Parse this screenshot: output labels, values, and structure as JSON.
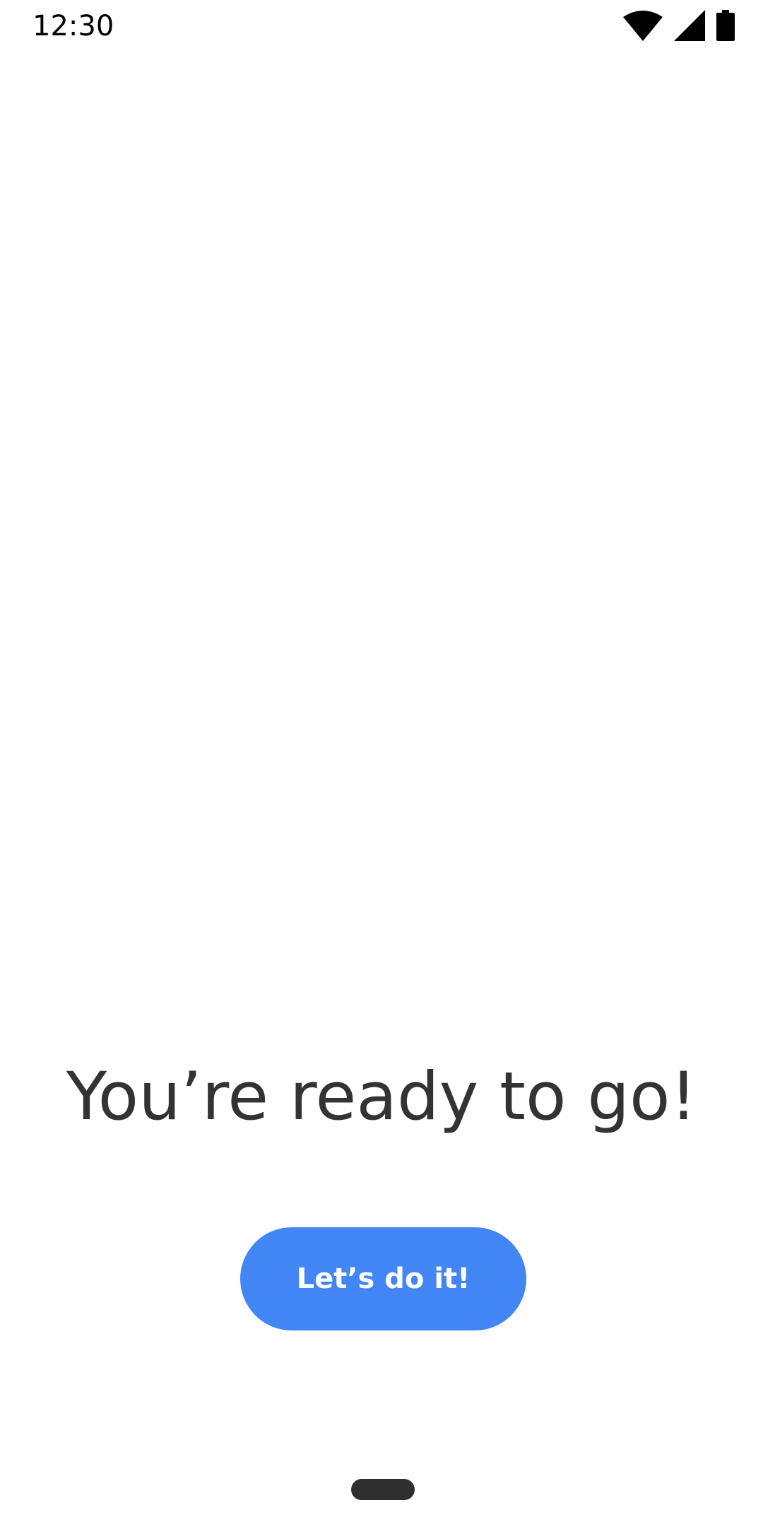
{
  "status_bar": {
    "time": "12:30",
    "icons": [
      "wifi-icon",
      "cell-signal-icon",
      "battery-icon"
    ]
  },
  "main": {
    "headline": "You’re ready to go!",
    "button_label": "Let’s do it!"
  },
  "colors": {
    "background": "#FFFFFF",
    "headline_text": "#333333",
    "button_background": "#4285F4",
    "button_text": "#FFFFFF",
    "nav_pill": "#2F2F2F"
  },
  "navigation": {
    "gesture_handle": "home-gesture-pill"
  }
}
